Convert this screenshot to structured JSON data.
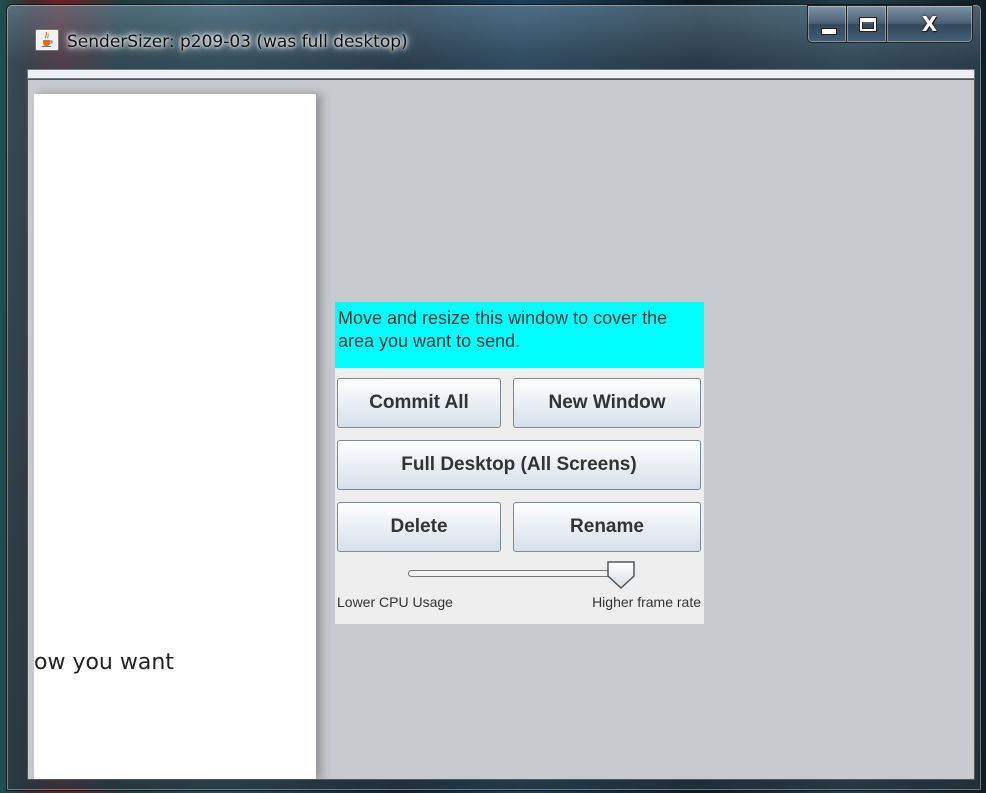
{
  "window": {
    "title": "SenderSizer: p209-03 (was full desktop)",
    "minimize_icon": "minimize-icon",
    "maximize_icon": "maximize-icon",
    "close_label": "X"
  },
  "content": {
    "partial_text": "ow you want",
    "message": "Move and resize this window to cover the area you want to send.",
    "buttons": {
      "commit_all": "Commit All",
      "new_window": "New Window",
      "full_desktop": "Full Desktop (All Screens)",
      "delete": "Delete",
      "rename": "Rename"
    },
    "slider": {
      "min_label": "Lower CPU Usage",
      "max_label": "Higher frame rate",
      "value": 0.95
    }
  },
  "colors": {
    "message_bg": "#00ffff",
    "client_bg": "#c6c9cd",
    "panel_bg": "#eeeeee"
  }
}
